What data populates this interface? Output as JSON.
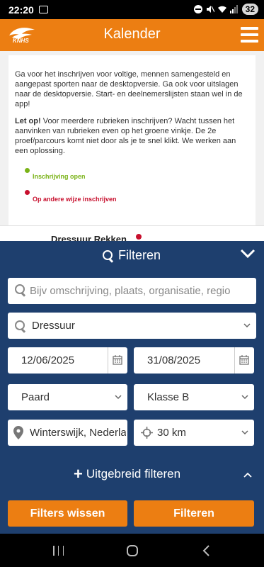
{
  "status_bar": {
    "time": "22:20",
    "battery": "32"
  },
  "app_bar": {
    "title": "Kalender",
    "logo_text": "KNHS"
  },
  "content": {
    "intro": "Ga voor het inschrijven voor voltige, mennen samengesteld en aangepast sporten naar de desktopversie. Ga ook voor uitslagen naar de desktopversie. Start- en deelnemerslijsten staan wel in de app!",
    "warning_bold": "Let op!",
    "warning_text": " Voor meerdere rubrieken inschrijven? Wacht tussen het aanvinken van rubrieken even op het groene vinkje. De 2e proef/parcours komt niet door als je te snel klikt. We werken aan een oplossing.",
    "legend": [
      {
        "label": "Inschrijving open",
        "color": "#7ab317"
      },
      {
        "label": "Op andere wijze inschrijven",
        "color": "#c8102e"
      }
    ],
    "list_item_title": "Dressuur Rekken"
  },
  "filter": {
    "title": "Filteren",
    "search_placeholder": "Bijv omschrijving, plaats, organisatie, regio",
    "discipline": "Dressuur",
    "date_from": "12/06/2025",
    "date_to": "31/08/2025",
    "animal": "Paard",
    "class": "Klasse B",
    "location": "Winterswijk, Nederla",
    "radius": "30 km",
    "extended_label": "Uitgebreid filteren",
    "clear_button": "Filters wissen",
    "apply_button": "Filteren"
  },
  "colors": {
    "accent": "#ec7e12",
    "panel": "#1e3f6e"
  }
}
